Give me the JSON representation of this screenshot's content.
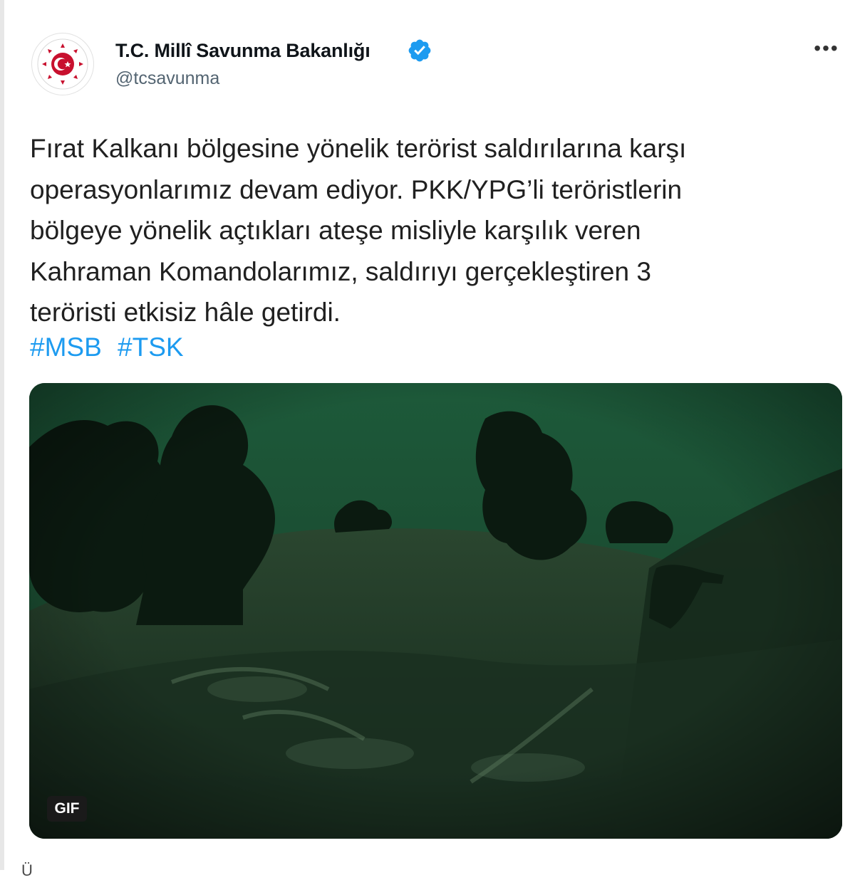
{
  "account": {
    "display_name": "T.C. Millî Savunma Bakanlığı",
    "handle": "@tcsavunma",
    "verified": true,
    "avatar_icon": "ministry-emblem-icon",
    "brand_color": "#c8102e"
  },
  "menu": {
    "more_icon": "more-horizontal-icon",
    "label": "•••"
  },
  "tweet": {
    "lines": [
      "Fırat Kalkanı bölgesine yönelik terörist saldırılarına karşı",
      "operasyonlarımız devam ediyor. PKK/YPG’li teröristlerin",
      "bölgeye yönelik açtıkları ateşe misliyle karşılık veren",
      "Kahraman Komandolarımız, saldırıyı gerçekleştiren 3",
      "teröristi etkisiz hâle getirdi."
    ],
    "hashtags": [
      "#MSB",
      "#TSK"
    ],
    "hashtag_color": "#1d9bf0"
  },
  "media": {
    "type": "gif",
    "badge": "GIF",
    "scene": "night-vision-green"
  },
  "bottom_partial_text": "Ü"
}
